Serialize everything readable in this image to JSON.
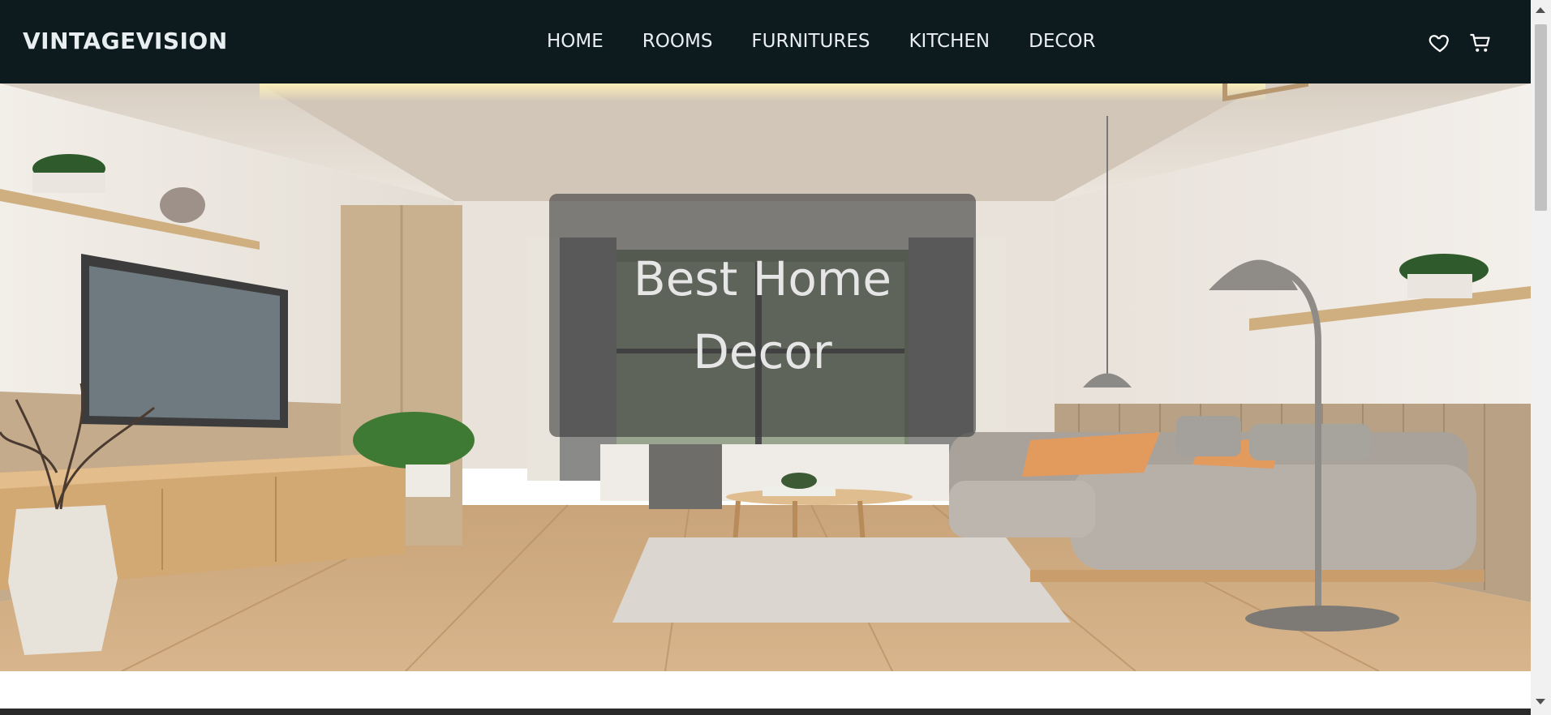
{
  "brand": {
    "name": "VINTAGEVISION"
  },
  "nav": {
    "items": [
      {
        "label": "HOME"
      },
      {
        "label": "ROOMS"
      },
      {
        "label": "FURNITURES"
      },
      {
        "label": "KITCHEN"
      },
      {
        "label": "DECOR"
      }
    ],
    "icons": [
      "heart-icon",
      "cart-icon"
    ]
  },
  "hero": {
    "title": "Best Home Decor"
  },
  "colors": {
    "navbar": "#0d1b1f",
    "overlay": "#3c3c3c"
  }
}
